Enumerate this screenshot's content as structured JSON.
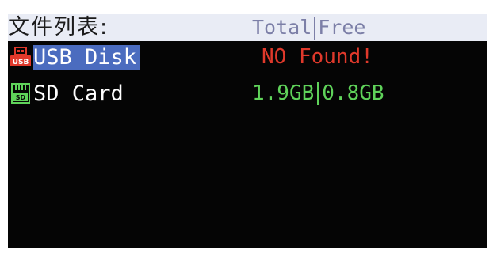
{
  "header": {
    "title": "文件列表:",
    "col_total": "Total",
    "col_free": "Free"
  },
  "devices": [
    {
      "name": "USB Disk",
      "icon": "usb-icon",
      "status": "NO Found!",
      "selected": true
    },
    {
      "name": "SD Card",
      "icon": "sd-card-icon",
      "total": "1.9GB",
      "free": "0.8GB",
      "selected": false
    }
  ],
  "colors": {
    "screen_bg": "#050505",
    "header_bg": "#e9ecf5",
    "header_text": "#7c7fa7",
    "selection_bg": "#4b6cbf",
    "error_text": "#e0392b",
    "capacity_text": "#5fd35a",
    "usb_icon": "#e0392b",
    "sd_icon": "#5fd35a"
  }
}
